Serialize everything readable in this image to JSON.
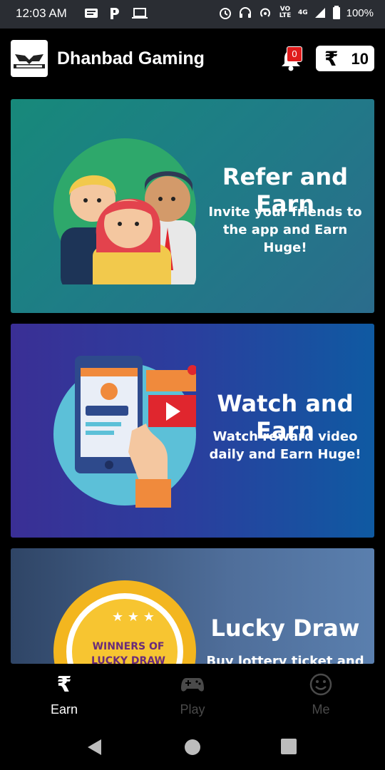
{
  "status_bar": {
    "time": "12:03 AM",
    "network": "4G",
    "volte": "VO LTE",
    "battery": "100%"
  },
  "app_bar": {
    "title": "Dhanbad Gaming",
    "notification_count": "0",
    "currency_symbol": "₹",
    "wallet_balance": "10"
  },
  "cards": [
    {
      "title": "Refer and Earn",
      "subtitle_line1": "Invite your friends to",
      "subtitle_line2": "the app and Earn Huge!"
    },
    {
      "title": "Watch and Earn",
      "subtitle_line1": "Watch reward video",
      "subtitle_line2": "daily and Earn Huge!"
    },
    {
      "title": "Lucky Draw",
      "subtitle_line1": "Buy lottery ticket and",
      "badge_line1": "WINNERS OF",
      "badge_line2": "LUCKY DRAW"
    }
  ],
  "bottom_nav": {
    "items": [
      {
        "label": "Earn",
        "icon": "rupee-icon",
        "active": true
      },
      {
        "label": "Play",
        "icon": "gamepad-icon",
        "active": false
      },
      {
        "label": "Me",
        "icon": "smiley-icon",
        "active": false
      }
    ]
  },
  "colors": {
    "refer_card": "#1e7d86",
    "watch_card": "#2a3f9e",
    "lucky_card": "#4f6e9a",
    "badge_red": "#e01b1b"
  }
}
